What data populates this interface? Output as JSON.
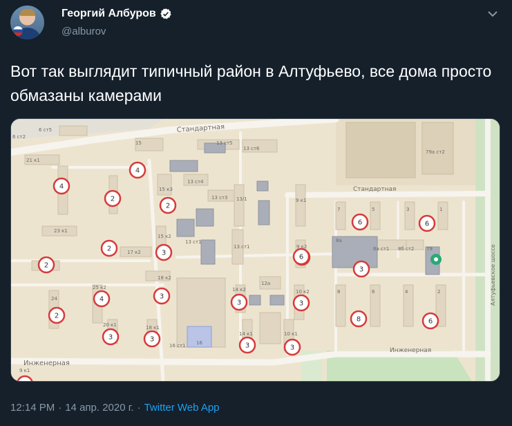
{
  "author": {
    "name": "Георгий Албуров",
    "handle": "@alburov"
  },
  "tweet": {
    "text": "Вот так выглядит типичный район в Алтуфьево, все дома просто обмазаны камерами"
  },
  "map": {
    "street_labels": [
      "Стандартная",
      "Стандартная",
      "Инженерная",
      "Инженерная",
      "Алтуфьевское шоссе"
    ],
    "building_labels": [
      "6 ст2",
      "6 ст5",
      "15",
      "13 ст5",
      "13 ст6",
      "21 к1",
      "13 ст4",
      "13 ст3",
      "15 к3",
      "13/1",
      "9 к1",
      "7",
      "5",
      "3",
      "1",
      "79а ст2",
      "23 к1",
      "15 к2",
      "13 ст1",
      "13 ст1",
      "9 к2",
      "8а",
      "8а ст1",
      "8б ст2",
      "79",
      "17 к2",
      "18 к2",
      "12а",
      "14 к2",
      "10 к2",
      "25 к2",
      "24",
      "8",
      "6",
      "4",
      "2",
      "20 к1",
      "18 к1",
      "16 ст1",
      "16",
      "14 к1",
      "10 к1",
      "9 к1"
    ],
    "camera_counts": [
      4,
      4,
      2,
      2,
      6,
      6,
      2,
      2,
      3,
      3,
      6,
      3,
      4,
      3,
      3,
      3,
      2,
      8,
      6,
      3,
      3,
      3,
      3,
      2
    ]
  },
  "footer": {
    "time": "12:14 PM",
    "date": "14 апр. 2020 г.",
    "separator": "·",
    "app": "Twitter Web App"
  }
}
